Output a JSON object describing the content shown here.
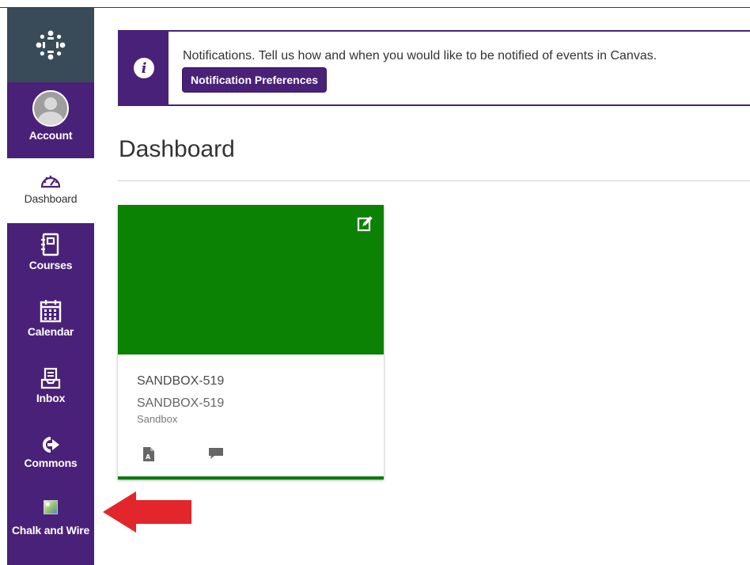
{
  "sidebar": {
    "items": [
      {
        "id": "account",
        "label": "Account",
        "icon": "user-avatar-icon"
      },
      {
        "id": "dashboard",
        "label": "Dashboard",
        "icon": "dashboard-gauge-icon",
        "active": true
      },
      {
        "id": "courses",
        "label": "Courses",
        "icon": "courses-book-icon"
      },
      {
        "id": "calendar",
        "label": "Calendar",
        "icon": "calendar-icon"
      },
      {
        "id": "inbox",
        "label": "Inbox",
        "icon": "inbox-tray-icon"
      },
      {
        "id": "commons",
        "label": "Commons",
        "icon": "commons-arrow-icon"
      },
      {
        "id": "chalk-and-wire",
        "label": "Chalk and Wire",
        "icon": "broken-image-icon"
      }
    ]
  },
  "notification": {
    "text": "Notifications.  Tell us how and when you would like to be notified of events in Canvas.",
    "button_label": "Notification Preferences"
  },
  "page": {
    "title": "Dashboard"
  },
  "card": {
    "title": "SANDBOX-519",
    "course_code": "SANDBOX-519",
    "term": "Sandbox",
    "hero_color": "#0b8203"
  },
  "colors": {
    "brand_purple": "#4a2178",
    "logo_background": "#394b58",
    "annotation_arrow": "#e3262b"
  }
}
